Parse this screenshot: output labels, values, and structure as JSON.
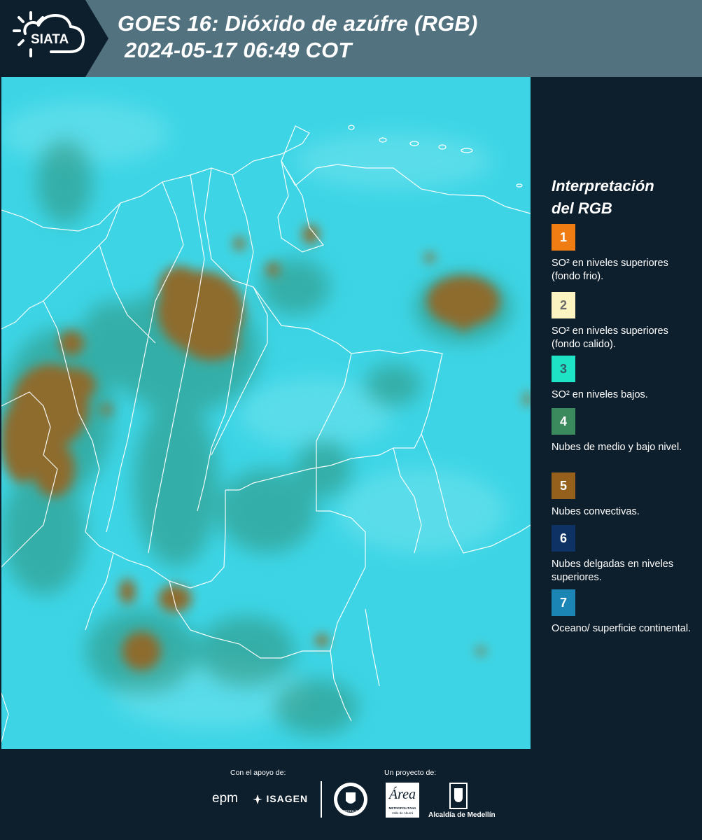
{
  "header": {
    "logo_text": "SIATA",
    "title_line1": "GOES 16: Dióxido de azúfre (RGB)",
    "title_line2": "2024-05-17 06:49 COT"
  },
  "legend": {
    "title_line1": "Interpretación",
    "title_line2": "del RGB",
    "items": [
      {
        "number": "1",
        "color": "#f07c14",
        "number_color": "#ffffff",
        "text": "SO² en niveles superiores (fondo frio)."
      },
      {
        "number": "2",
        "color": "#fbf3c0",
        "number_color": "#6a6a6a",
        "text": "SO² en niveles superiores (fondo calido)."
      },
      {
        "number": "3",
        "color": "#1fe3c5",
        "number_color": "#2f5b66",
        "text": "SO² en niveles bajos."
      },
      {
        "number": "4",
        "color": "#3a8a5e",
        "number_color": "#ffffff",
        "text": "Nubes de medio y bajo nivel."
      },
      {
        "number": "5",
        "color": "#94601b",
        "number_color": "#ffffff",
        "text": "Nubes convectivas."
      },
      {
        "number": "6",
        "color": "#0e3263",
        "number_color": "#ffffff",
        "text": "Nubes delgadas en niveles superiores."
      },
      {
        "number": "7",
        "color": "#1b86b5",
        "number_color": "#ffffff",
        "text": "Oceano/ superficie continental."
      }
    ]
  },
  "footer": {
    "support_label": "Con el apoyo de:",
    "project_label": "Un proyecto de:",
    "sponsors": {
      "epm": "epm",
      "isagen": "ISAGEN",
      "area_metro": "Área",
      "area_metro_sub1": "METROPOLITANA",
      "area_metro_sub2": "Valle de Aburrá",
      "alcaldia": "Alcaldía de Medellín",
      "medellin_seal": "MEDELLÍN"
    }
  },
  "map": {
    "ocean_color": "#3dd5e6",
    "cloud_color": "#8d6c2e",
    "low_cloud_color": "#2f8f76",
    "border_color": "#ffffff"
  }
}
